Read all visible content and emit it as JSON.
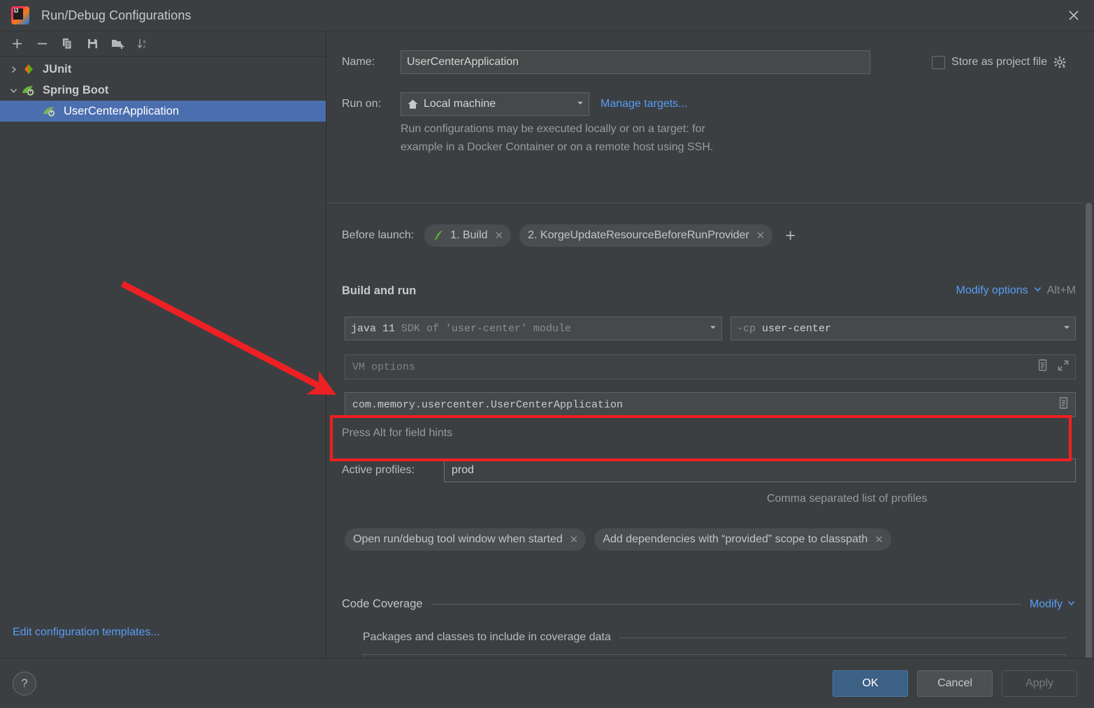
{
  "window": {
    "title": "Run/Debug Configurations",
    "logo_icon": "intellij-idea-logo",
    "close_icon": "close-icon"
  },
  "sidebar": {
    "toolbar": [
      {
        "name": "add-configuration-button",
        "icon": "plus-icon"
      },
      {
        "name": "remove-configuration-button",
        "icon": "minus-icon"
      },
      {
        "name": "copy-configuration-button",
        "icon": "copy-icon"
      },
      {
        "name": "save-configuration-button",
        "icon": "save-icon"
      },
      {
        "name": "move-into-folder-button",
        "icon": "new-folder-icon"
      },
      {
        "name": "sort-configurations-button",
        "icon": "sort-alphabetically-icon"
      }
    ],
    "tree": [
      {
        "label": "JUnit",
        "icon": "junit-icon",
        "twisty": "chevron-right-icon",
        "level": "group",
        "selected": false
      },
      {
        "label": "Spring Boot",
        "icon": "spring-boot-icon",
        "twisty": "chevron-down-icon",
        "level": "group",
        "selected": false
      },
      {
        "label": "UserCenterApplication",
        "icon": "spring-boot-icon",
        "twisty": "",
        "level": "child",
        "selected": true
      }
    ],
    "edit_templates_link": "Edit configuration templates..."
  },
  "form": {
    "name_label": "Name:",
    "name_value": "UserCenterApplication",
    "store_as_project_file_label": "Store as project file",
    "store_as_project_file_checked": false,
    "store_gear_icon": "gear-icon",
    "run_on_label": "Run on:",
    "run_on_value": "Local machine",
    "run_on_icon": "home-icon",
    "manage_targets_link": "Manage targets...",
    "run_on_hint_line1": "Run configurations may be executed locally or on a target: for",
    "run_on_hint_line2": "example in a Docker Container or on a remote host using SSH.",
    "before_launch_label": "Before launch:",
    "before_launch_tasks": [
      {
        "label": "1. Build",
        "icon": "hammer-icon",
        "remove_icon": "close-small-icon"
      },
      {
        "label": "2. KorgeUpdateResourceBeforeRunProvider",
        "icon": "",
        "remove_icon": "close-small-icon"
      }
    ],
    "before_launch_add_icon": "plus-icon",
    "build_and_run_heading": "Build and run",
    "modify_options_link": "Modify options",
    "modify_options_caret": "chevron-down-icon",
    "modify_options_shortcut": "Alt+M",
    "sdk_value_strong": "java 11",
    "sdk_value_dim": "SDK of 'user-center' module",
    "classpath_value_dim": "-cp",
    "classpath_value_strong": "user-center",
    "vm_options_placeholder": "VM options",
    "vm_options_value": "",
    "vm_macro_icon": "macro-icon",
    "vm_expand_icon": "expand-icon",
    "main_class_value": "com.memory.usercenter.UserCenterApplication",
    "main_class_macro_icon": "macro-icon",
    "alt_hint": "Press Alt for field hints",
    "active_profiles_label": "Active profiles:",
    "active_profiles_value": "prod",
    "active_profiles_hint": "Comma separated list of profiles",
    "option_chips": [
      {
        "label": "Open run/debug tool window when started",
        "remove_icon": "close-small-icon"
      },
      {
        "label": "Add dependencies with “provided” scope to classpath",
        "remove_icon": "close-small-icon"
      }
    ],
    "code_coverage_heading": "Code Coverage",
    "code_coverage_modify_link": "Modify",
    "code_coverage_modify_caret": "chevron-down-icon",
    "packages_heading": "Packages and classes to include in coverage data",
    "packages_toolbar": [
      {
        "name": "remove-package-button",
        "icon": "minus-icon"
      },
      {
        "name": "add-package-button",
        "icon": "plus-dropdown-icon"
      }
    ]
  },
  "footer": {
    "help_label": "?",
    "ok_label": "OK",
    "cancel_label": "Cancel",
    "apply_label": "Apply"
  },
  "annotations": {
    "highlight_color": "#ef2020",
    "arrow_color": "#ef2020"
  },
  "colors": {
    "background": "#3c3f41",
    "selection": "#4b6eaf",
    "link": "#589df6",
    "primary_button": "#3d6185"
  }
}
